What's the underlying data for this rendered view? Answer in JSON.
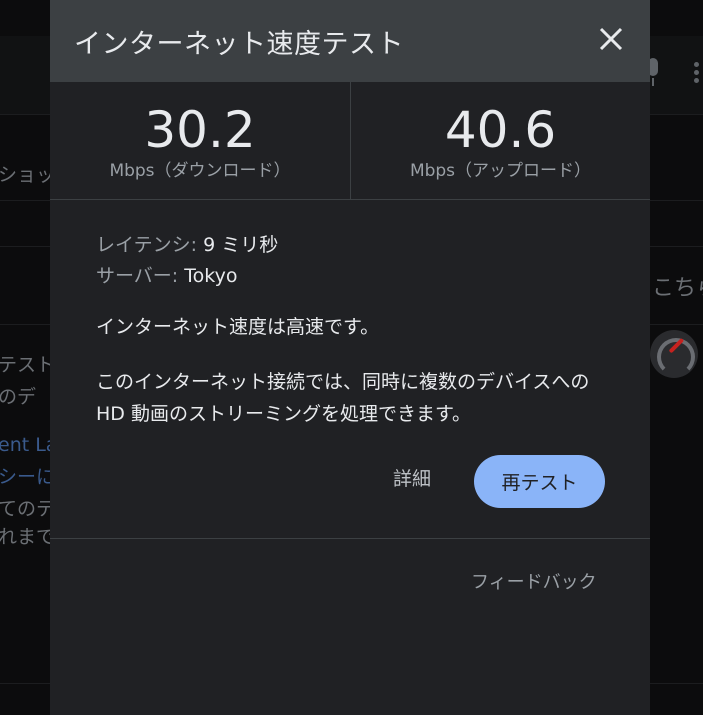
{
  "background": {
    "fragments": [
      {
        "text": "ショッ",
        "x_ref": "left"
      },
      {
        "text": "テスト"
      },
      {
        "text": "のデ"
      },
      {
        "text": "ent La"
      },
      {
        "text": "シーに"
      },
      {
        "text": "てのテ"
      },
      {
        "text": "れまで"
      },
      {
        "text": "こちら"
      }
    ]
  },
  "dialog": {
    "title": "インターネット速度テスト",
    "close_icon": "close-icon",
    "download": {
      "value": "30.2",
      "unit": "Mbps（ダウンロード）"
    },
    "upload": {
      "value": "40.6",
      "unit": "Mbps（アップロード）"
    },
    "latency": {
      "label": "レイテンシ: ",
      "value": "9 ミリ秒"
    },
    "server": {
      "label": "サーバー: ",
      "value": "Tokyo"
    },
    "verdict": "インターネット速度は高速です。",
    "description": "このインターネット接続では、同時に複数のデバイスへの HD 動画のストリーミングを処理できます。",
    "details_label": "詳細",
    "retest_label": "再テスト",
    "feedback_label": "フィードバック"
  },
  "colors": {
    "dialog_bg": "#202124",
    "header_bg": "#3c4043",
    "accent": "#8ab4f8",
    "text_primary": "#e8eaed",
    "text_secondary": "#9aa0a6"
  }
}
